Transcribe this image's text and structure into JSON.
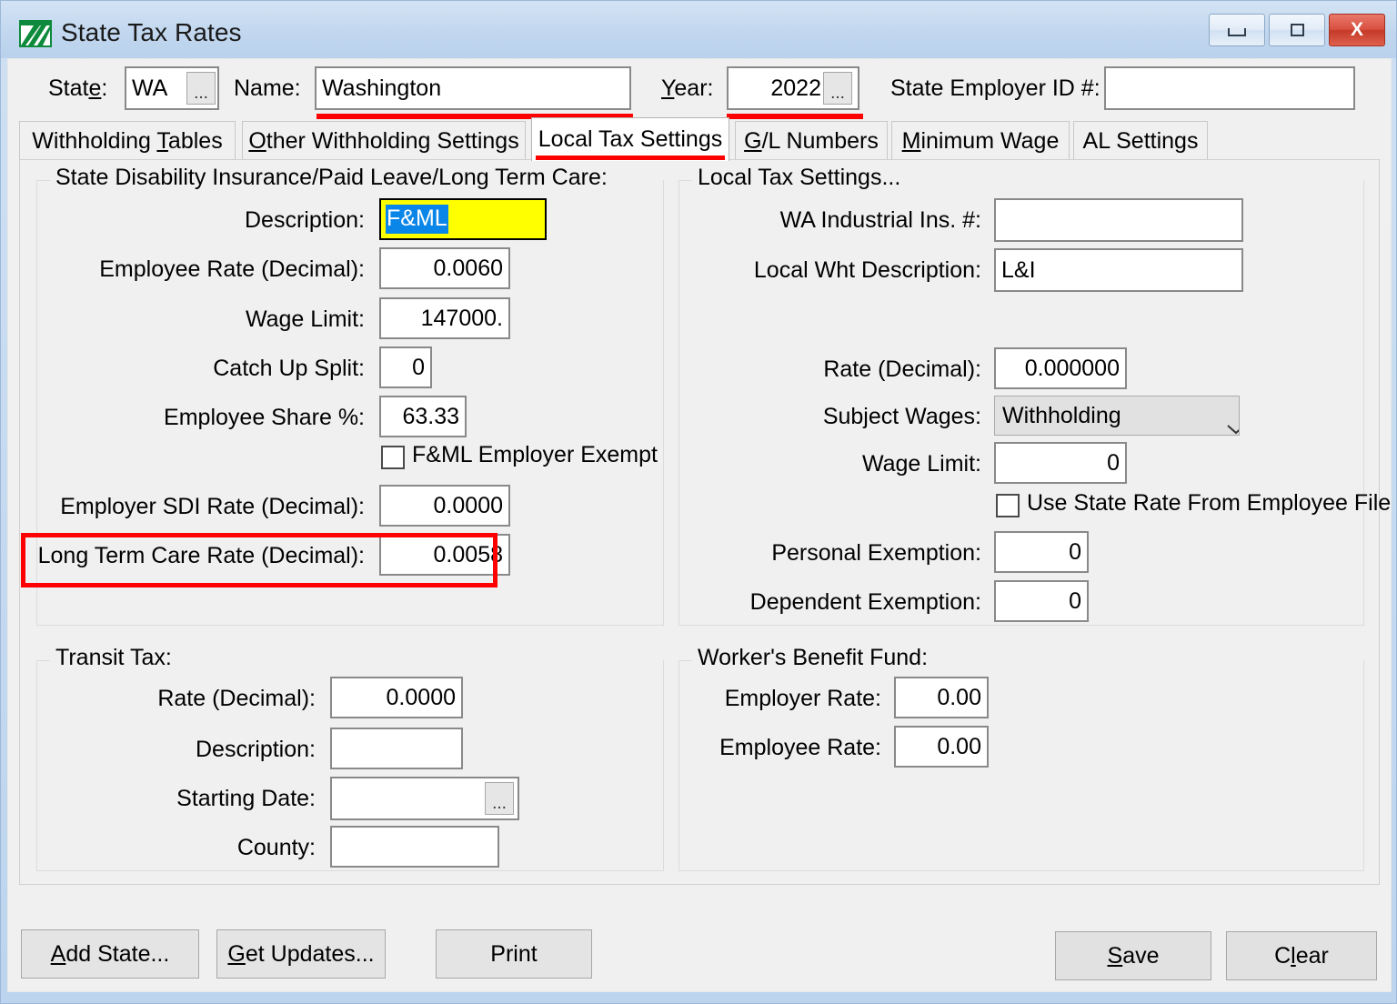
{
  "window": {
    "title": "State Tax Rates",
    "icon": "green-table-icon",
    "buttons": {
      "minimize": "minimize-icon",
      "maximize": "maximize-icon",
      "close": "X"
    }
  },
  "header": {
    "state_label": "State:",
    "state_value": "WA",
    "state_browse": "...",
    "name_label": "Name:",
    "name_value": "Washington",
    "year_label": "Year:",
    "year_value": "2022",
    "year_browse": "...",
    "employer_id_label": "State Employer ID #:",
    "employer_id_value": ""
  },
  "tabs": [
    {
      "label": "Withholding Tables",
      "active": false
    },
    {
      "label": "Other Withholding Settings",
      "active": false
    },
    {
      "label": "Local Tax Settings",
      "active": true
    },
    {
      "label": "G/L Numbers",
      "active": false
    },
    {
      "label": "Minimum Wage",
      "active": false
    },
    {
      "label": "AL Settings",
      "active": false
    }
  ],
  "sdi_group": {
    "title": "State Disability Insurance/Paid Leave/Long Term Care:",
    "description_label": "Description:",
    "description_value": "F&ML",
    "employee_rate_label": "Employee Rate (Decimal):",
    "employee_rate_value": "0.0060",
    "wage_limit_label": "Wage Limit:",
    "wage_limit_value": "147000.",
    "catch_up_split_label": "Catch Up Split:",
    "catch_up_split_value": "0",
    "employee_share_label": "Employee Share %:",
    "employee_share_value": "63.33",
    "employer_exempt_label": "F&ML Employer Exempt",
    "employer_exempt_checked": false,
    "employer_sdi_rate_label": "Employer SDI Rate (Decimal):",
    "employer_sdi_rate_value": "0.0000",
    "ltc_rate_label": "Long Term Care Rate (Decimal):",
    "ltc_rate_value": "0.0058"
  },
  "local_group": {
    "title": "Local Tax Settings...",
    "industrial_ins_label": "WA Industrial Ins. #:",
    "industrial_ins_value": "",
    "local_wht_desc_label": "Local Wht Description:",
    "local_wht_desc_value": "L&I",
    "rate_label": "Rate (Decimal):",
    "rate_value": "0.000000",
    "subject_wages_label": "Subject Wages:",
    "subject_wages_value": "Withholding",
    "subject_wages_options": [
      "Withholding"
    ],
    "wage_limit_label": "Wage Limit:",
    "wage_limit_value": "0",
    "use_state_rate_label": "Use State Rate From Employee File",
    "use_state_rate_checked": false,
    "personal_exemption_label": "Personal Exemption:",
    "personal_exemption_value": "0",
    "dependent_exemption_label": "Dependent Exemption:",
    "dependent_exemption_value": "0"
  },
  "transit_group": {
    "title": "Transit Tax:",
    "rate_label": "Rate (Decimal):",
    "rate_value": "0.0000",
    "description_label": "Description:",
    "description_value": "",
    "starting_date_label": "Starting Date:",
    "starting_date_value": "",
    "starting_date_browse": "...",
    "county_label": "County:",
    "county_value": ""
  },
  "wbf_group": {
    "title": "Worker's Benefit Fund:",
    "employer_rate_label": "Employer Rate:",
    "employer_rate_value": "0.00",
    "employee_rate_label": "Employee Rate:",
    "employee_rate_value": "0.00"
  },
  "footer": {
    "add_state": "Add State...",
    "get_updates": "Get Updates...",
    "print": "Print",
    "save": "Save",
    "clear": "Clear"
  },
  "annotations": {
    "highlight_color": "#ff0000",
    "underline_name": true,
    "underline_year": true,
    "underline_active_tab": true,
    "box_long_term_care_rate": true
  }
}
